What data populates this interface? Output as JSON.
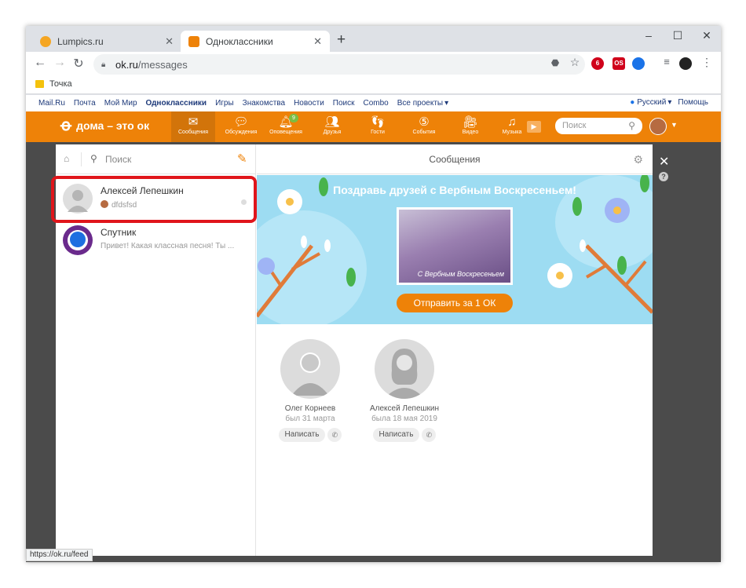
{
  "browser": {
    "tabs": [
      {
        "title": "Lumpics.ru",
        "active": false,
        "favicon_color": "#f5a623"
      },
      {
        "title": "Одноклассники",
        "active": true,
        "favicon_color": "#ee8208"
      }
    ],
    "url_host": "ok.ru",
    "url_path": "/messages",
    "bookmark": "Точка",
    "status_url": "https://ok.ru/feed"
  },
  "portal": {
    "links": [
      "Mail.Ru",
      "Почта",
      "Мой Мир",
      "Одноклассники",
      "Игры",
      "Знакомства",
      "Новости",
      "Поиск",
      "Combo",
      "Все проекты"
    ],
    "language": "Русский",
    "help": "Помощь"
  },
  "okbar": {
    "logo": "дома – это ок",
    "nav": [
      {
        "label": "Сообщения",
        "icon": "envelope-icon",
        "active": true
      },
      {
        "label": "Обсуждения",
        "icon": "chat-bubbles-icon"
      },
      {
        "label": "Оповещения",
        "icon": "bell-icon",
        "badge": "9"
      },
      {
        "label": "Друзья",
        "icon": "friends-icon"
      },
      {
        "label": "Гости",
        "icon": "footprints-icon"
      },
      {
        "label": "События",
        "icon": "events-icon"
      },
      {
        "label": "Видео",
        "icon": "video-camera-icon"
      },
      {
        "label": "Музыка",
        "icon": "music-note-icon"
      }
    ],
    "search_placeholder": "Поиск"
  },
  "messages": {
    "search_placeholder": "Поиск",
    "header_title": "Сообщения",
    "conversations": [
      {
        "name": "Алексей Лепешкин",
        "preview": "dfdsfsd",
        "highlighted": true
      },
      {
        "name": "Спутник",
        "preview": "Привет! Какая классная песня! Ты ..."
      }
    ],
    "banner": {
      "title": "Поздравь друзей с Вербным Воскресеньем!",
      "card_caption": "С Вербным Воскресеньем",
      "button": "Отправить за 1 ОК"
    },
    "friends": [
      {
        "name": "Олег Корнеев",
        "status": "был 31 марта",
        "write": "Написать"
      },
      {
        "name": "Алексей Лепешкин",
        "status": "была 18 мая 2019",
        "write": "Написать"
      }
    ]
  },
  "colors": {
    "ok_orange": "#ee8208",
    "highlight_red": "#e0151b",
    "banner_blue": "#9ddcf2"
  }
}
